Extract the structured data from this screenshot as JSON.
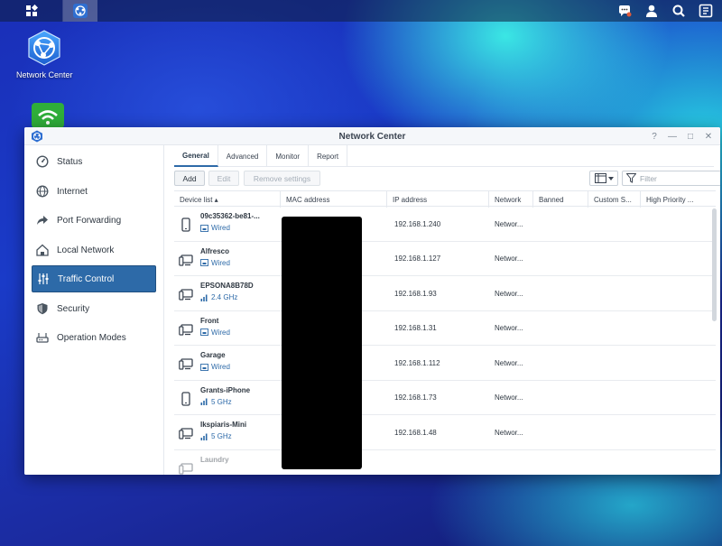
{
  "taskbar": {
    "main_menu_icon": "grid-icon",
    "active_app_icon": "network-center-icon",
    "right_icons": [
      "notification-chat-icon",
      "user-icon",
      "search-icon",
      "widgets-icon"
    ]
  },
  "desktop": {
    "icons": [
      {
        "label": "Network Center",
        "icon": "network-center-icon"
      },
      {
        "label": "",
        "icon": "wifi-icon"
      }
    ]
  },
  "window": {
    "title": "Network Center",
    "controls": [
      "?",
      "—",
      "□",
      "✕"
    ]
  },
  "sidebar": {
    "items": [
      {
        "label": "Status",
        "icon": "gauge-icon"
      },
      {
        "label": "Internet",
        "icon": "globe-icon"
      },
      {
        "label": "Port Forwarding",
        "icon": "arrow-forward-icon"
      },
      {
        "label": "Local Network",
        "icon": "house-icon"
      },
      {
        "label": "Traffic Control",
        "icon": "sliders-icon",
        "active": true
      },
      {
        "label": "Security",
        "icon": "shield-icon"
      },
      {
        "label": "Operation Modes",
        "icon": "router-icon"
      }
    ]
  },
  "tabs": [
    {
      "label": "General",
      "active": true
    },
    {
      "label": "Advanced"
    },
    {
      "label": "Monitor"
    },
    {
      "label": "Report"
    }
  ],
  "toolbar": {
    "add_label": "Add",
    "edit_label": "Edit",
    "remove_label": "Remove settings",
    "filter_placeholder": "Filter"
  },
  "columns": [
    "Device list ▴",
    "MAC address",
    "IP address",
    "Network",
    "Banned",
    "Custom S...",
    "High Priority ..."
  ],
  "devices": [
    {
      "name": "09c35362-be81-...",
      "conn": "Wired",
      "conn_type": "wired",
      "device": "phone",
      "ip": "192.168.1.240",
      "network": "Networ..."
    },
    {
      "name": "Alfresco",
      "conn": "Wired",
      "conn_type": "wired",
      "device": "computer",
      "ip": "192.168.1.127",
      "network": "Networ..."
    },
    {
      "name": "EPSONA8B78D",
      "conn": "2.4 GHz",
      "conn_type": "wifi",
      "device": "computer",
      "ip": "192.168.1.93",
      "network": "Networ..."
    },
    {
      "name": "Front",
      "conn": "Wired",
      "conn_type": "wired",
      "device": "computer",
      "ip": "192.168.1.31",
      "network": "Networ..."
    },
    {
      "name": "Garage",
      "conn": "Wired",
      "conn_type": "wired",
      "device": "computer",
      "ip": "192.168.1.112",
      "network": "Networ..."
    },
    {
      "name": "Grants-iPhone",
      "conn": "5 GHz",
      "conn_type": "wifi",
      "device": "phone",
      "ip": "192.168.1.73",
      "network": "Networ..."
    },
    {
      "name": "Ikspiaris-Mini",
      "conn": "5 GHz",
      "conn_type": "wifi",
      "device": "computer",
      "ip": "192.168.1.48",
      "network": "Networ..."
    },
    {
      "name": "Laundry",
      "conn": "",
      "conn_type": "",
      "device": "computer",
      "ip": "",
      "network": ""
    }
  ],
  "colors": {
    "accent": "#2d6aa8",
    "sidebar_active": "#2d6aa8",
    "link": "#2d6aa8"
  }
}
